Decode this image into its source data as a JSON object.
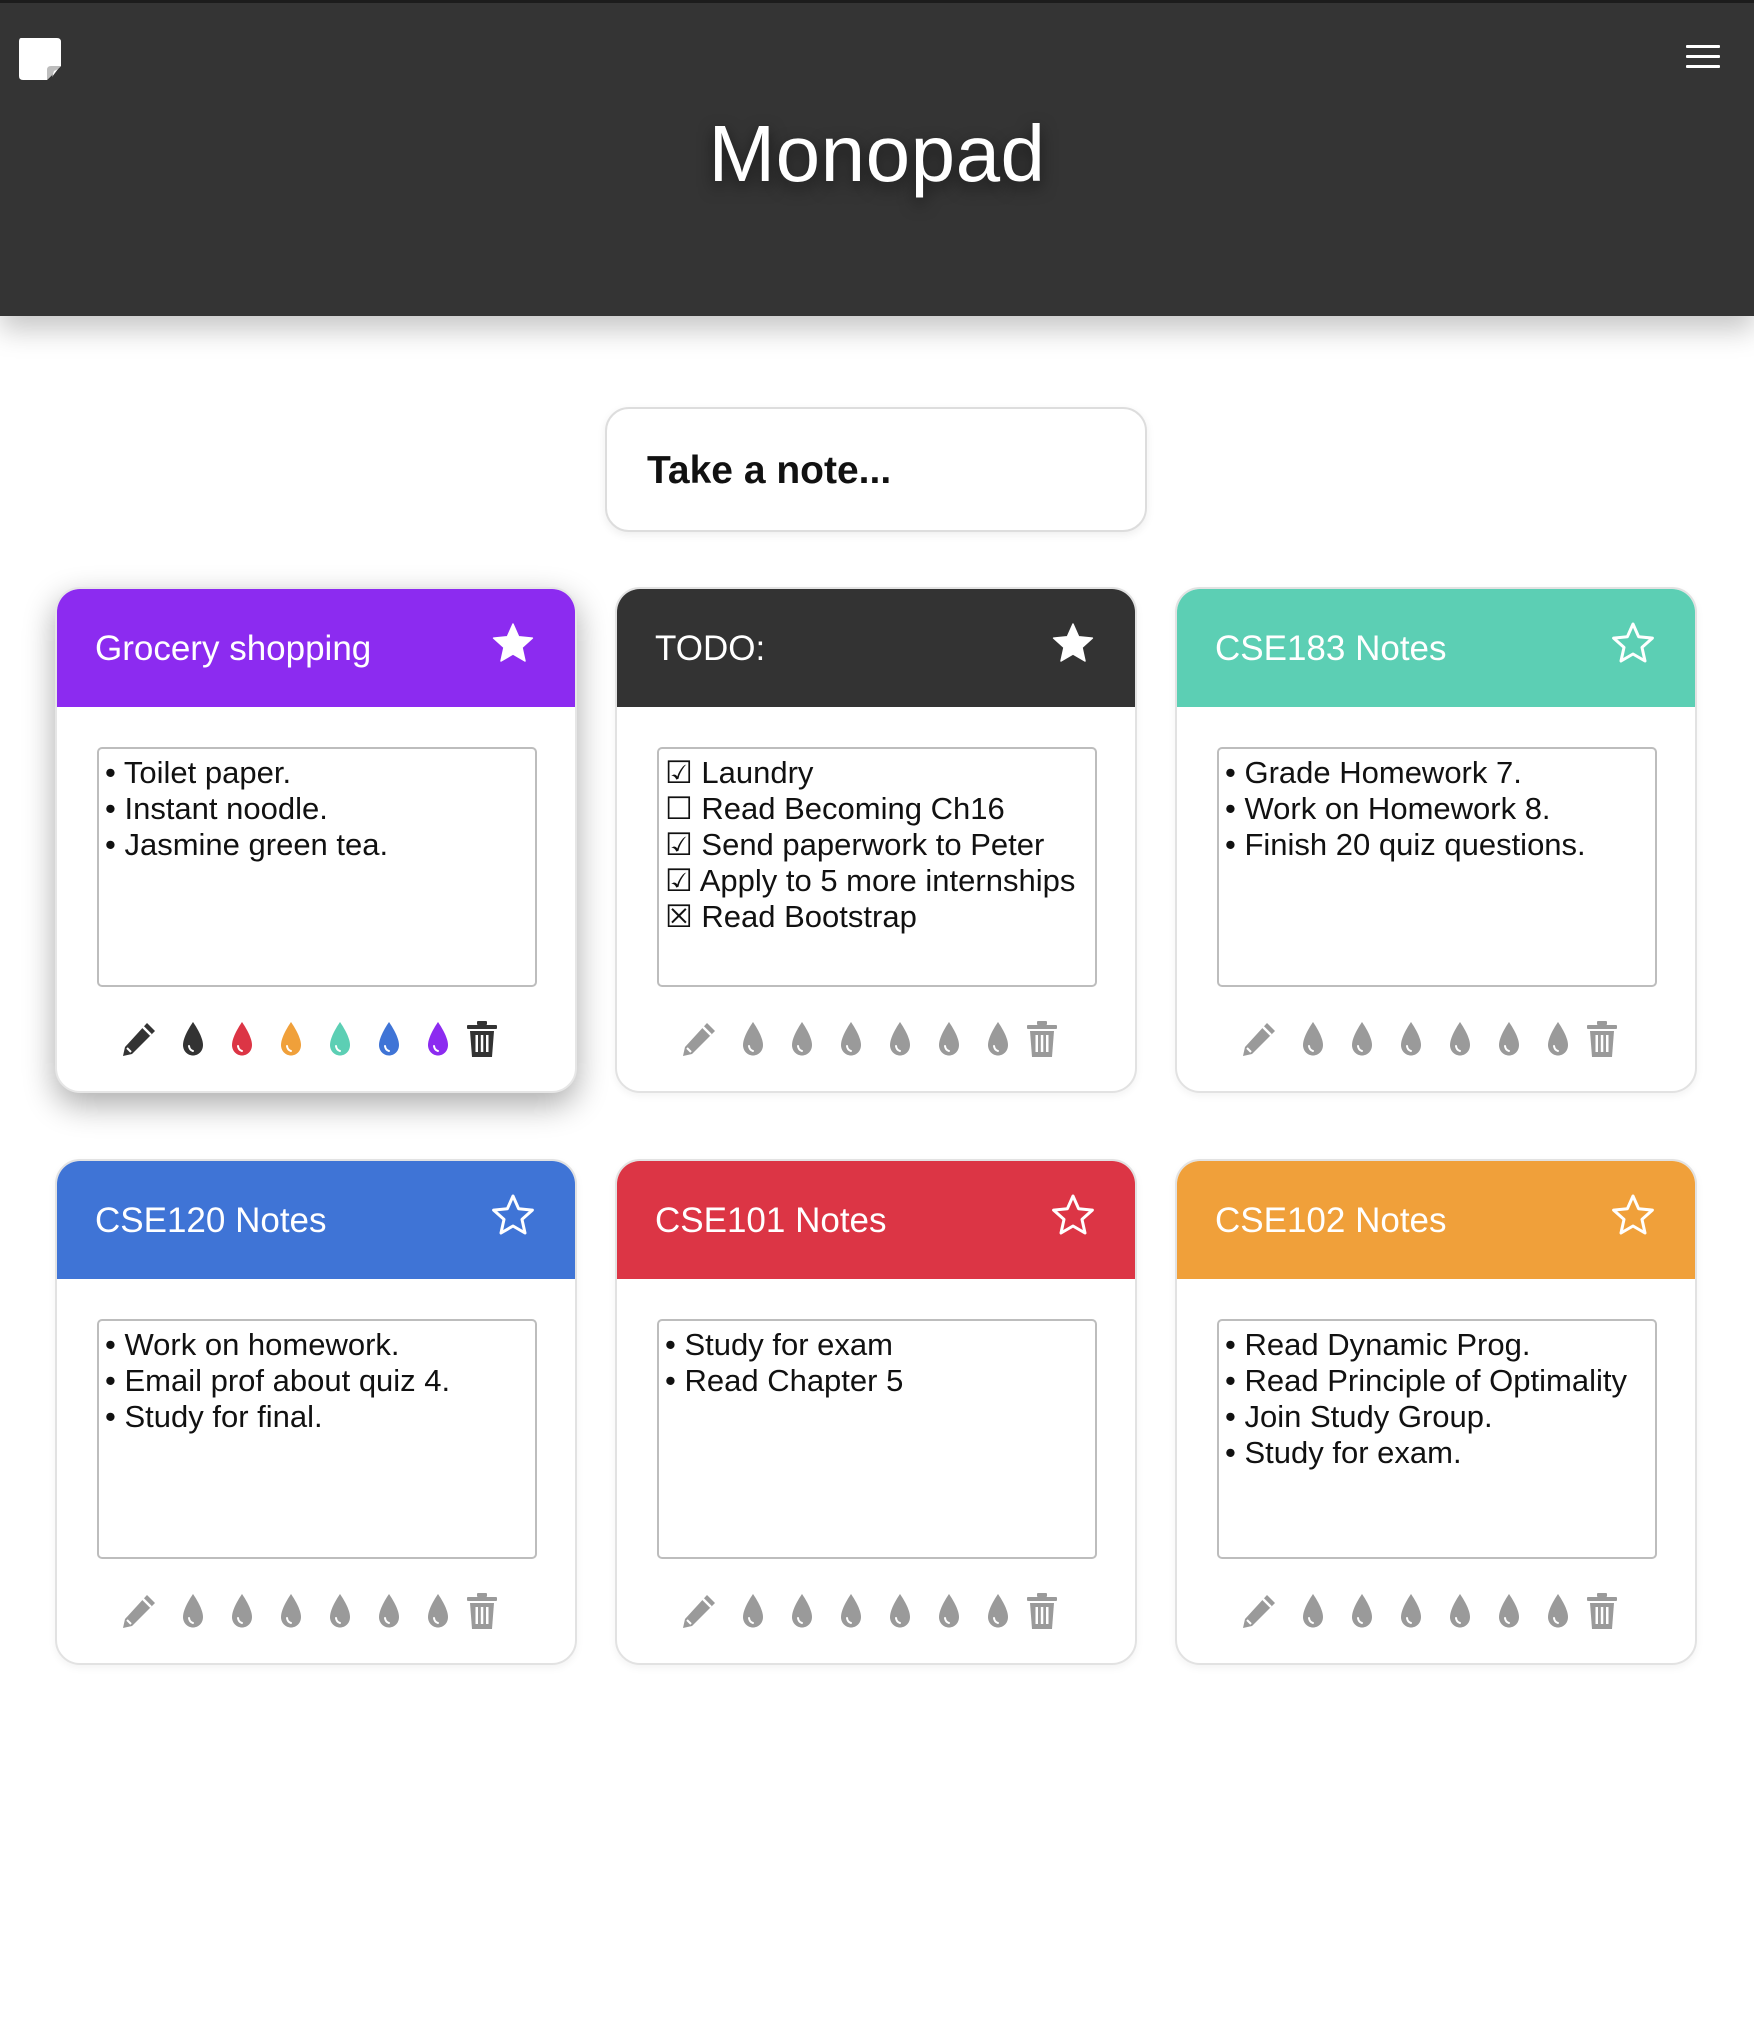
{
  "header": {
    "logo_icon": "sticky-note-icon",
    "title": "Monopad",
    "menu_icon": "hamburger-menu-icon",
    "background": "#343434"
  },
  "composer": {
    "placeholder": "Take a note..."
  },
  "palette": [
    "#333333",
    "#dc3545",
    "#f0a03a",
    "#5ccfb4",
    "#3f74d6",
    "#8c2bf0"
  ],
  "notes": [
    {
      "title": "Grocery shopping",
      "color": "#8c2bf0",
      "starred": true,
      "active": true,
      "lines": [
        "• Toilet paper.",
        "• Instant noodle.",
        "• Jasmine green tea."
      ]
    },
    {
      "title": "TODO:",
      "color": "#333333",
      "starred": true,
      "active": false,
      "lines": [
        "☑ Laundry",
        "☐ Read Becoming Ch16",
        "☑ Send paperwork to Peter",
        "☑ Apply to 5 more internships",
        "☒ Read Bootstrap"
      ]
    },
    {
      "title": "CSE183 Notes",
      "color": "#5ccfb4",
      "starred": false,
      "active": false,
      "lines": [
        "• Grade Homework 7.",
        "• Work on Homework 8.",
        "• Finish 20 quiz questions."
      ]
    },
    {
      "title": "CSE120 Notes",
      "color": "#3f74d6",
      "starred": false,
      "active": false,
      "lines": [
        "• Work on homework.",
        "• Email prof about quiz 4.",
        "• Study for final."
      ]
    },
    {
      "title": "CSE101 Notes",
      "color": "#dc3545",
      "starred": false,
      "active": false,
      "lines": [
        "• Study for exam",
        "• Read Chapter 5"
      ]
    },
    {
      "title": "CSE102 Notes",
      "color": "#f0a03a",
      "starred": false,
      "active": false,
      "lines": [
        "• Read Dynamic Prog.",
        "• Read Principle of Optimality",
        "• Join Study Group.",
        "• Study for exam."
      ]
    }
  ],
  "toolbar_icons": [
    "pencil-icon",
    "droplet-icon",
    "trash-icon"
  ],
  "inactive_icon_color": "#9a9a9a",
  "active_icon_color": "#333333"
}
